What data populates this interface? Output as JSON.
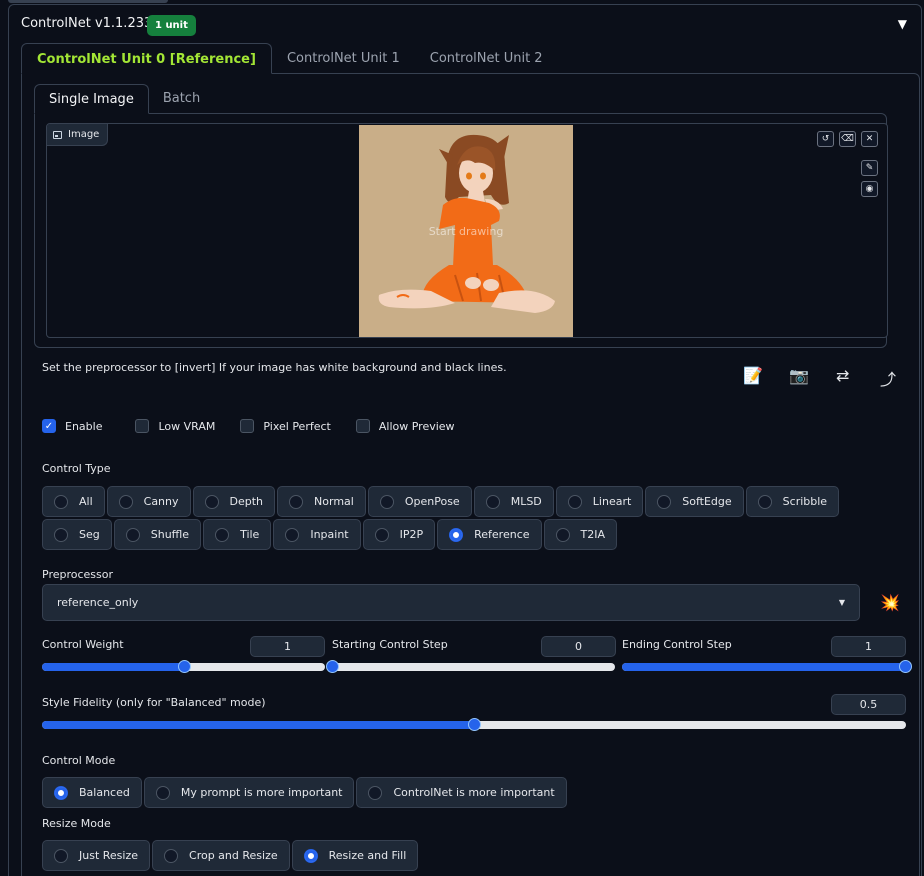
{
  "header": {
    "title": "ControlNet v1.1.233",
    "badge": "1 unit",
    "collapse_icon": "triangle-down-icon"
  },
  "unit_tabs": [
    {
      "label": "ControlNet Unit 0 [Reference]",
      "active": true
    },
    {
      "label": "ControlNet Unit 1",
      "active": false
    },
    {
      "label": "ControlNet Unit 2",
      "active": false
    }
  ],
  "image_tabs": [
    {
      "label": "Single Image",
      "active": true
    },
    {
      "label": "Batch",
      "active": false
    }
  ],
  "image_panel": {
    "label": "Image",
    "overlay_text": "Start drawing",
    "buttons": [
      "undo-icon",
      "eraser-icon",
      "close-icon",
      "brush-icon",
      "palette-icon"
    ]
  },
  "hint": "Set the preprocessor to [invert] If your image has white background and black lines.",
  "tool_icons": [
    "memo-icon",
    "camera-icon",
    "swap-icon",
    "curved-arrow-icon"
  ],
  "checkboxes": [
    {
      "label": "Enable",
      "checked": true
    },
    {
      "label": "Low VRAM",
      "checked": false
    },
    {
      "label": "Pixel Perfect",
      "checked": false
    },
    {
      "label": "Allow Preview",
      "checked": false
    }
  ],
  "control_type": {
    "label": "Control Type",
    "options": [
      "All",
      "Canny",
      "Depth",
      "Normal",
      "OpenPose",
      "MLSD",
      "Lineart",
      "SoftEdge",
      "Scribble",
      "Seg",
      "Shuffle",
      "Tile",
      "Inpaint",
      "IP2P",
      "Reference",
      "T2IA"
    ],
    "selected": "Reference"
  },
  "preprocessor": {
    "label": "Preprocessor",
    "value": "reference_only",
    "run_icon": "explosion-icon"
  },
  "sliders": {
    "control_weight": {
      "label": "Control Weight",
      "value": "1",
      "min": 0,
      "max": 2,
      "fraction": 0.5
    },
    "starting_step": {
      "label": "Starting Control Step",
      "value": "0",
      "min": 0,
      "max": 1,
      "fraction": 0
    },
    "ending_step": {
      "label": "Ending Control Step",
      "value": "1",
      "min": 0,
      "max": 1,
      "fraction": 1
    },
    "style_fidelity": {
      "label": "Style Fidelity (only for \"Balanced\" mode)",
      "value": "0.5",
      "min": 0,
      "max": 1,
      "fraction": 0.5
    }
  },
  "control_mode": {
    "label": "Control Mode",
    "options": [
      "Balanced",
      "My prompt is more important",
      "ControlNet is more important"
    ],
    "selected": "Balanced"
  },
  "resize_mode": {
    "label": "Resize Mode",
    "options": [
      "Just Resize",
      "Crop and Resize",
      "Resize and Fill"
    ],
    "selected": "Resize and Fill"
  },
  "colors": {
    "accent": "#2563eb",
    "active_tab": "#a3e635",
    "badge": "#15803d",
    "background": "#0b0f19"
  }
}
